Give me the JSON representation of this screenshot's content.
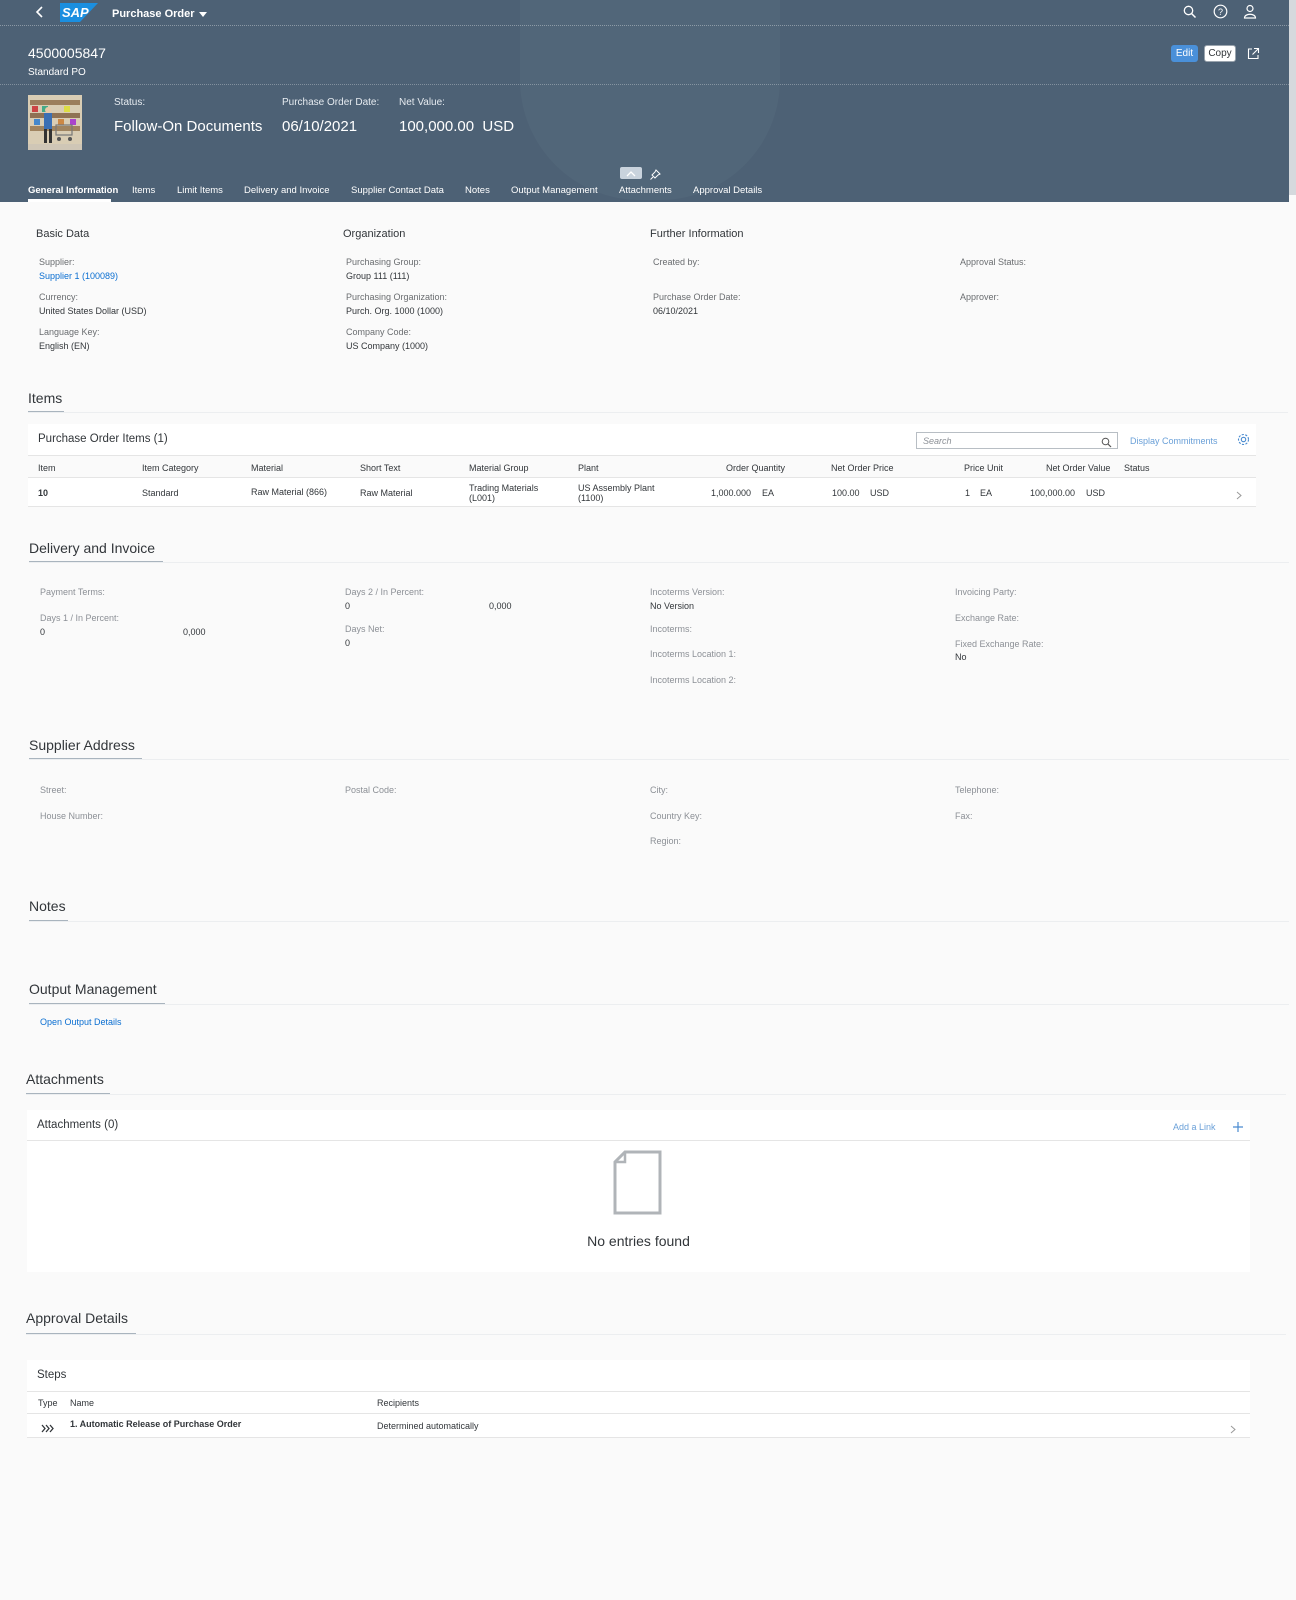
{
  "shell": {
    "app_title": "Purchase Order",
    "logo_text": "SAP"
  },
  "header": {
    "po_number": "4500005847",
    "po_type": "Standard PO",
    "status_label": "Status:",
    "status_value": "Follow-On Documents",
    "date_label": "Purchase Order Date:",
    "date_value": "06/10/2021",
    "net_label": "Net Value:",
    "net_value": "100,000.00",
    "net_currency": "USD",
    "edit_label": "Edit",
    "copy_label": "Copy"
  },
  "tabs": [
    "General Information",
    "Items",
    "Limit Items",
    "Delivery and Invoice",
    "Supplier Contact Data",
    "Notes",
    "Output Management",
    "Attachments",
    "Approval Details"
  ],
  "general": {
    "basic_title": "Basic Data",
    "org_title": "Organization",
    "further_title": "Further Information",
    "supplier_label": "Supplier:",
    "supplier_value": "Supplier 1 (100089)",
    "currency_label": "Currency:",
    "currency_value": "United States Dollar (USD)",
    "language_label": "Language Key:",
    "language_value": "English (EN)",
    "pgroup_label": "Purchasing Group:",
    "pgroup_value": "Group 111 (111)",
    "porg_label": "Purchasing Organization:",
    "porg_value": "Purch. Org. 1000 (1000)",
    "company_label": "Company Code:",
    "company_value": "US Company (1000)",
    "created_label": "Created by:",
    "podate_label": "Purchase Order Date:",
    "podate_value": "06/10/2021",
    "approval_status_label": "Approval Status:",
    "approver_label": "Approver:"
  },
  "items": {
    "section_title": "Items",
    "table_title": "Purchase Order Items (1)",
    "search_placeholder": "Search",
    "display_commitments": "Display Commitments",
    "columns": [
      "Item",
      "Item Category",
      "Material",
      "Short Text",
      "Material Group",
      "Plant",
      "Order Quantity",
      "Net Order Price",
      "Price Unit",
      "Net Order Value",
      "Status"
    ],
    "row": {
      "item": "10",
      "category": "Standard",
      "material": "Raw Material (866)",
      "short_text": "Raw Material",
      "mat_group_1": "Trading Materials",
      "mat_group_2": "(L001)",
      "plant_1": "US Assembly Plant",
      "plant_2": "(1100)",
      "qty": "1,000.000",
      "qty_unit": "EA",
      "price": "100.00",
      "price_cur": "USD",
      "price_unit": "1",
      "price_unit_uom": "EA",
      "value": "100,000.00",
      "value_cur": "USD"
    }
  },
  "delivery": {
    "section_title": "Delivery and Invoice",
    "payment_terms": "Payment Terms:",
    "days1_label": "Days 1 / In Percent:",
    "days1_value": "0",
    "days1_pct": "0,000",
    "days2_label": "Days 2 / In Percent:",
    "days2_value": "0",
    "days2_pct": "0,000",
    "daysnet_label": "Days Net:",
    "daysnet_value": "0",
    "inco_version_label": "Incoterms Version:",
    "inco_version_value": "No Version",
    "incoterms_label": "Incoterms:",
    "inco_loc1_label": "Incoterms Location 1:",
    "inco_loc2_label": "Incoterms Location 2:",
    "invoicing_label": "Invoicing Party:",
    "exchange_label": "Exchange Rate:",
    "fixed_label": "Fixed Exchange Rate:",
    "fixed_value": "No"
  },
  "supplier_address": {
    "section_title": "Supplier Address",
    "street": "Street:",
    "house": "House Number:",
    "postal": "Postal Code:",
    "city": "City:",
    "country": "Country Key:",
    "region": "Region:",
    "telephone": "Telephone:",
    "fax": "Fax:"
  },
  "notes": {
    "section_title": "Notes"
  },
  "output": {
    "section_title": "Output Management",
    "link": "Open Output Details"
  },
  "attachments": {
    "section_title": "Attachments",
    "panel_title": "Attachments (0)",
    "add_link": "Add a Link",
    "empty_text": "No entries found"
  },
  "approval": {
    "section_title": "Approval Details",
    "steps_title": "Steps",
    "col_type": "Type",
    "col_name": "Name",
    "col_recipients": "Recipients",
    "step_name": "1. Automatic Release of Purchase Order",
    "step_recipients": "Determined automatically"
  },
  "colors": {
    "header_bg": "#4d6175",
    "accent": "#0a6ed1",
    "edit_button": "#4a90d9"
  }
}
